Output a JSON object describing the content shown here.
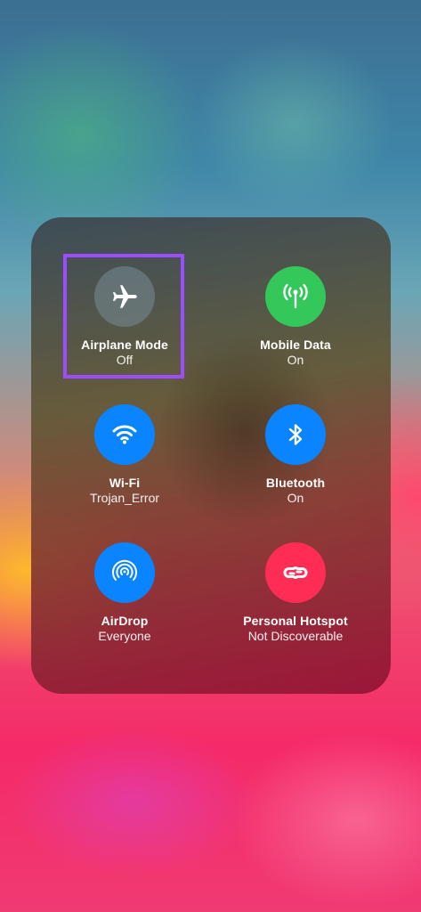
{
  "tiles": [
    {
      "label": "Airplane Mode",
      "status": "Off",
      "icon": "airplane-icon",
      "color": "#7d8c95",
      "state": "off"
    },
    {
      "label": "Mobile Data",
      "status": "On",
      "icon": "antenna-icon",
      "color": "#34c759",
      "state": "on"
    },
    {
      "label": "Wi-Fi",
      "status": "Trojan_Error",
      "icon": "wifi-icon",
      "color": "#0a84ff",
      "state": "on"
    },
    {
      "label": "Bluetooth",
      "status": "On",
      "icon": "bluetooth-icon",
      "color": "#0a84ff",
      "state": "on"
    },
    {
      "label": "AirDrop",
      "status": "Everyone",
      "icon": "airdrop-icon",
      "color": "#0a84ff",
      "state": "on"
    },
    {
      "label": "Personal Hotspot",
      "status": "Not Discoverable",
      "icon": "hotspot-icon",
      "color": "#ff2d55",
      "state": "on"
    }
  ],
  "highlight": {
    "target": "Airplane Mode",
    "color": "#9b4dff"
  }
}
